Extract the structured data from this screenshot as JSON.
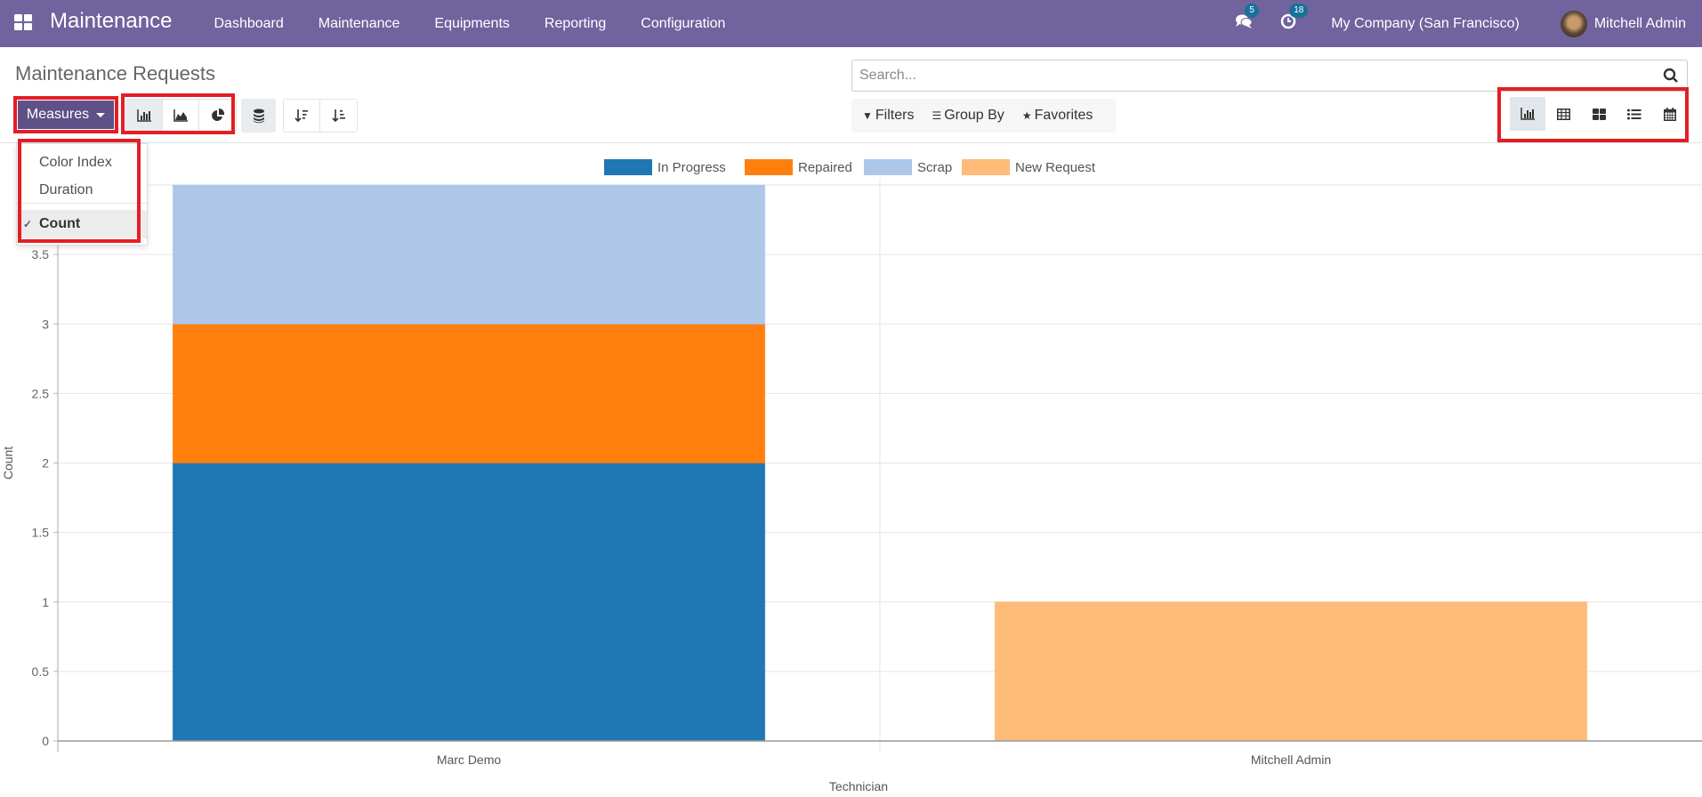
{
  "navbar": {
    "app_name": "Maintenance",
    "menu": [
      "Dashboard",
      "Maintenance",
      "Equipments",
      "Reporting",
      "Configuration"
    ],
    "messages_count": "5",
    "activities_count": "18",
    "company": "My Company (San Francisco)",
    "user": "Mitchell Admin"
  },
  "control_panel": {
    "title": "Maintenance Requests",
    "measures_label": "Measures",
    "chart_types": [
      "bar-chart-icon",
      "line-chart-icon",
      "pie-chart-icon"
    ],
    "active_chart_type": "bar",
    "stacked_active": true,
    "search_placeholder": "Search...",
    "filters_label": "Filters",
    "groupby_label": "Group By",
    "favorites_label": "Favorites",
    "views": [
      "graph",
      "pivot",
      "kanban",
      "list",
      "calendar"
    ],
    "active_view": "graph"
  },
  "measures_dropdown": {
    "items": [
      "Color Index",
      "Duration"
    ],
    "selected": "Count",
    "check": "✓"
  },
  "colors": {
    "navbar": "#71639e",
    "primary_button": "#5f5088",
    "highlight": "#e31e25"
  },
  "chart_data": {
    "type": "bar",
    "stacked": true,
    "categories": [
      "Marc Demo",
      "Mitchell Admin"
    ],
    "series": [
      {
        "name": "In Progress",
        "color": "#1f77b4",
        "values": [
          2,
          0
        ]
      },
      {
        "name": "Repaired",
        "color": "#ff7f0e",
        "values": [
          1,
          0
        ]
      },
      {
        "name": "Scrap",
        "color": "#aec7e8",
        "values": [
          1,
          0
        ]
      },
      {
        "name": "New Request",
        "color": "#ffbb78",
        "values": [
          0,
          1
        ]
      }
    ],
    "xlabel": "Technician",
    "ylabel": "Count",
    "ylim": [
      0,
      4
    ],
    "yticks": [
      0,
      0.5,
      1,
      1.5,
      2,
      2.5,
      3,
      3.5
    ],
    "ytick_labels": [
      "0",
      "0.5",
      "1",
      "1.5",
      "2",
      "2.5",
      "3",
      "3.5"
    ],
    "grid": true,
    "legend_position": "top-center"
  }
}
